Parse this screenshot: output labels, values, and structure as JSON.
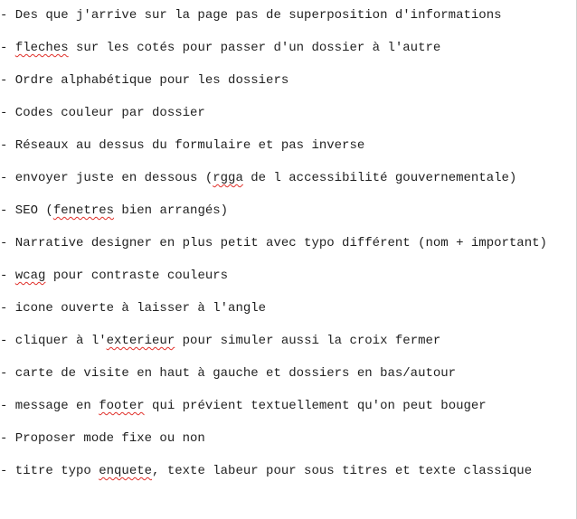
{
  "notes": [
    {
      "parts": [
        {
          "text": "- Des que j'arrive sur la page pas de superposition d'informations"
        }
      ]
    },
    {
      "parts": [
        {
          "text": "- "
        },
        {
          "text": "fleches",
          "spell": true
        },
        {
          "text": " sur les cotés pour passer d'un dossier à l'autre"
        }
      ]
    },
    {
      "parts": [
        {
          "text": "- Ordre alphabétique pour les dossiers"
        }
      ]
    },
    {
      "parts": [
        {
          "text": "- Codes couleur par dossier"
        }
      ]
    },
    {
      "parts": [
        {
          "text": "- Réseaux au dessus du formulaire et pas inverse"
        }
      ]
    },
    {
      "parts": [
        {
          "text": "- envoyer juste en dessous ("
        },
        {
          "text": "rgga",
          "spell": true
        },
        {
          "text": " de l accessibilité gouvernementale)"
        }
      ]
    },
    {
      "parts": [
        {
          "text": "- SEO ("
        },
        {
          "text": "fenetres",
          "spell": true
        },
        {
          "text": " bien arrangés)"
        }
      ]
    },
    {
      "parts": [
        {
          "text": "- Narrative designer en plus petit avec typo différent (nom + important)"
        }
      ]
    },
    {
      "parts": [
        {
          "text": "- "
        },
        {
          "text": "wcag",
          "spell": true
        },
        {
          "text": " pour contraste couleurs"
        }
      ]
    },
    {
      "parts": [
        {
          "text": "- icone ouverte à laisser à l'angle"
        }
      ]
    },
    {
      "parts": [
        {
          "text": "- cliquer à l'"
        },
        {
          "text": "exterieur",
          "spell": true
        },
        {
          "text": " pour simuler aussi la croix fermer"
        }
      ]
    },
    {
      "parts": [
        {
          "text": "- carte de visite en haut à gauche et dossiers en bas/autour"
        }
      ]
    },
    {
      "parts": [
        {
          "text": "- message en "
        },
        {
          "text": "footer",
          "spell": true
        },
        {
          "text": " qui prévient textuellement qu'on peut bouger"
        }
      ]
    },
    {
      "parts": [
        {
          "text": "- Proposer mode fixe ou non"
        }
      ]
    },
    {
      "parts": [
        {
          "text": "- titre typo "
        },
        {
          "text": "enquete",
          "spell": true
        },
        {
          "text": ", texte labeur pour sous titres et texte classique"
        }
      ]
    }
  ],
  "colors": {
    "text": "#1f1f1f",
    "spellcheck": "#e0302a",
    "background": "#ffffff"
  }
}
